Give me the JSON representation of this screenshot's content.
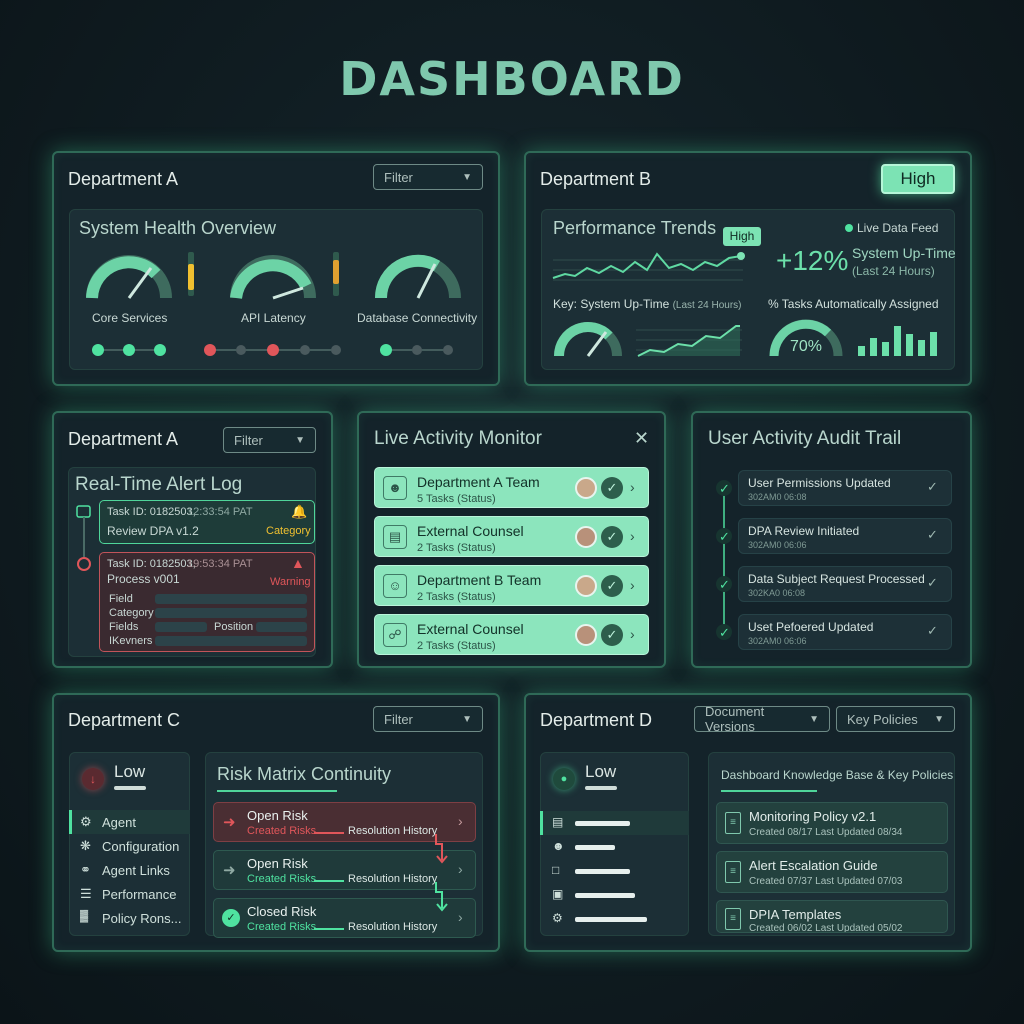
{
  "title": "DASHBOARD",
  "colors": {
    "accent": "#7fc8ad",
    "green": "#3fe29a",
    "red": "#e0565a",
    "yellow": "#f0c030",
    "panel": "#14232a"
  },
  "panel_a_top": {
    "title": "Department A",
    "filter": "Filter",
    "card_title": "System Health Overview",
    "gauges": [
      {
        "label": "Core Services",
        "level": 0.8
      },
      {
        "label": "API Latency",
        "level": 0.9
      },
      {
        "label": "Database Connectivity",
        "level": 0.75
      }
    ]
  },
  "panel_b_top": {
    "title": "Department B",
    "badge": "High",
    "card_title": "Performance Trends",
    "peak_label": "High",
    "live_feed": "Live Data Feed",
    "delta": "+12%",
    "uptime_label": "System Up-Time",
    "uptime_sub": "(Last 24 Hours)",
    "key_label": "Key: System Up-Time",
    "key_sub": "(Last 24 Hours)",
    "tasks_label": "% Tasks Automatically Assigned",
    "tasks_value": "70%"
  },
  "panel_alert": {
    "title": "Department A",
    "filter": "Filter",
    "card_title": "Real-Time Alert Log",
    "items": [
      {
        "task_id": "Task ID: 0182503,",
        "time": "12:33:54 PAT",
        "name": "Review DPA v1.2",
        "tag": "Category"
      },
      {
        "task_id": "Task ID: 0182503,",
        "time": "19:53:34 PAT",
        "name": "Process v001",
        "tag": "Warning"
      }
    ],
    "fields": [
      "Field",
      "Category",
      "Fields",
      "IKevners"
    ],
    "position_label": "Position"
  },
  "panel_activity": {
    "title": "Live Activity Monitor",
    "rows": [
      {
        "name": "Department A Team",
        "status": "5 Tasks (Status)"
      },
      {
        "name": "External Counsel",
        "status": "2 Tasks (Status)"
      },
      {
        "name": "Department B Team",
        "status": "2 Tasks (Status)"
      },
      {
        "name": "External Counsel",
        "status": "2 Tasks (Status)"
      }
    ]
  },
  "panel_audit": {
    "title": "User Activity Audit Trail",
    "items": [
      {
        "title": "User Permissions Updated",
        "date": "302AM0 06:08"
      },
      {
        "title": "DPA Review Initiated",
        "date": "302AM0 06:06"
      },
      {
        "title": "Data Subject Request Processed",
        "date": "302KA0 06:08"
      },
      {
        "title": "Uset Pefoered Updated",
        "date": "302AM0 06:06"
      }
    ]
  },
  "panel_c": {
    "title": "Department C",
    "filter": "Filter",
    "level": "Low",
    "menu": [
      "Agent",
      "Configuration",
      "Agent Links",
      "Performance",
      "Policy Rons..."
    ],
    "risk_title": "Risk Matrix Continuity",
    "risks": [
      {
        "title": "Open Risk",
        "sub": "Created Risks",
        "history": "Resolution History",
        "state": "red"
      },
      {
        "title": "Open Risk",
        "sub": "Created Risks",
        "history": "Resolution History",
        "state": "green"
      },
      {
        "title": "Closed Risk",
        "sub": "Created Risks",
        "history": "Resolution History",
        "state": "green"
      }
    ]
  },
  "panel_d": {
    "title": "Department D",
    "dropdown1": "Document Versions",
    "dropdown2": "Key Policies",
    "level": "Low",
    "kb_title": "Dashboard Knowledge Base & Key Policies",
    "docs": [
      {
        "title": "Monitoring Policy v2.1",
        "meta": "Created 08/17   Last Updated 08/34"
      },
      {
        "title": "Alert Escalation Guide",
        "meta": "Created 07/37   Last Updated 07/03"
      },
      {
        "title": "DPIA Templates",
        "meta": "Created 06/02   Last Updated 05/02"
      }
    ]
  }
}
